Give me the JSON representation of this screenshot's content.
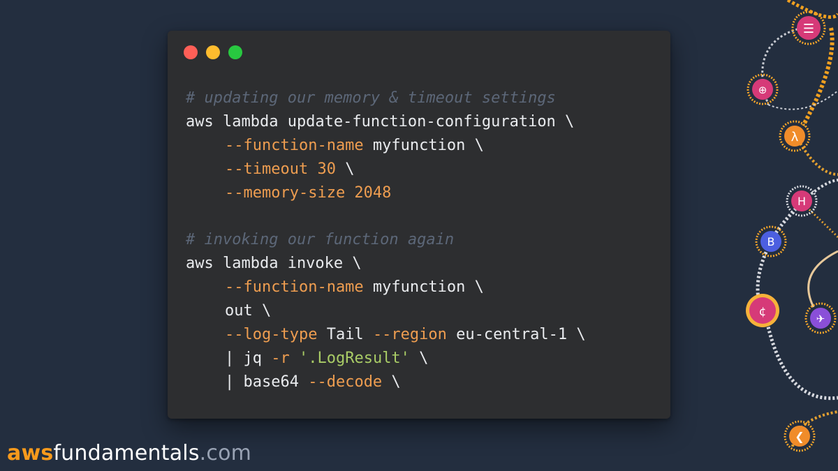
{
  "window": {
    "traffic_lights": [
      "#fe5f57",
      "#febc2e",
      "#28c840"
    ]
  },
  "code": {
    "lines": [
      {
        "indent": false,
        "tokens": [
          {
            "t": "comment",
            "v": "# updating our memory & timeout settings"
          }
        ]
      },
      {
        "indent": false,
        "tokens": [
          {
            "t": "arg",
            "v": "aws lambda update-function-configuration \\"
          }
        ]
      },
      {
        "indent": true,
        "tokens": [
          {
            "t": "flag",
            "v": "--function-name"
          },
          {
            "t": "arg",
            "v": " myfunction \\"
          }
        ]
      },
      {
        "indent": true,
        "tokens": [
          {
            "t": "flag",
            "v": "--timeout 30"
          },
          {
            "t": "arg",
            "v": " \\"
          }
        ]
      },
      {
        "indent": true,
        "tokens": [
          {
            "t": "flag",
            "v": "--memory-size 2048"
          }
        ]
      },
      {
        "indent": false,
        "tokens": []
      },
      {
        "indent": false,
        "tokens": [
          {
            "t": "comment",
            "v": "# invoking our function again"
          }
        ]
      },
      {
        "indent": false,
        "tokens": [
          {
            "t": "arg",
            "v": "aws lambda invoke \\"
          }
        ]
      },
      {
        "indent": true,
        "tokens": [
          {
            "t": "flag",
            "v": "--function-name"
          },
          {
            "t": "arg",
            "v": " myfunction \\"
          }
        ]
      },
      {
        "indent": true,
        "tokens": [
          {
            "t": "arg",
            "v": "out \\"
          }
        ]
      },
      {
        "indent": true,
        "tokens": [
          {
            "t": "flag",
            "v": "--log-type"
          },
          {
            "t": "arg",
            "v": " Tail "
          },
          {
            "t": "flag",
            "v": "--region"
          },
          {
            "t": "arg",
            "v": " eu-central-1 \\"
          }
        ]
      },
      {
        "indent": true,
        "tokens": [
          {
            "t": "arg",
            "v": "| jq "
          },
          {
            "t": "flag",
            "v": "-r"
          },
          {
            "t": "arg",
            "v": " "
          },
          {
            "t": "str",
            "v": "'.LogResult'"
          },
          {
            "t": "arg",
            "v": " \\"
          }
        ]
      },
      {
        "indent": true,
        "tokens": [
          {
            "t": "arg",
            "v": "| base64 "
          },
          {
            "t": "flag",
            "v": "--decode"
          },
          {
            "t": "arg",
            "v": " \\"
          }
        ]
      }
    ]
  },
  "brand": {
    "part1": "aws",
    "part2": "fundamentals",
    "part3": ".com",
    "accent_color": "#f89a1c"
  },
  "decoration": {
    "icons": [
      "network-icon",
      "vpc-icon",
      "lambda-icon",
      "hosted-zone-icon",
      "bucket-icon",
      "chip-icon",
      "route-icon",
      "arrow-icon"
    ]
  }
}
